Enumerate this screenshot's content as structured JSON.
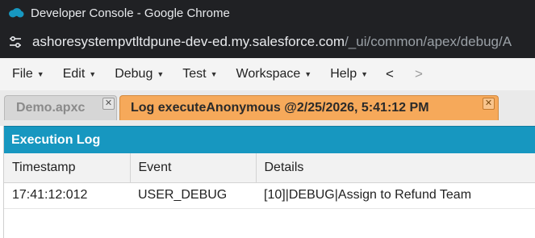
{
  "window": {
    "title": "Developer Console - Google Chrome",
    "logo_icon": "salesforce-cloud-icon"
  },
  "urlbar": {
    "host": "ashoresystempvtltdpune-dev-ed.my.salesforce.com",
    "path": "/_ui/common/apex/debug/A",
    "site_settings_icon": "tune-icon"
  },
  "menubar": {
    "items": [
      {
        "label": "File"
      },
      {
        "label": "Edit"
      },
      {
        "label": "Debug"
      },
      {
        "label": "Test"
      },
      {
        "label": "Workspace"
      },
      {
        "label": "Help"
      }
    ],
    "back_label": "<",
    "forward_label": ">"
  },
  "tabs": [
    {
      "label": "Demo.apxc",
      "active": false
    },
    {
      "label": "Log executeAnonymous @2/25/2026, 5:41:12 PM",
      "active": true
    }
  ],
  "panel": {
    "title": "Execution Log",
    "columns": [
      "Timestamp",
      "Event",
      "Details"
    ],
    "rows": [
      {
        "timestamp": "17:41:12:012",
        "event": "USER_DEBUG",
        "details": "[10]|DEBUG|Assign to Refund Team"
      }
    ]
  },
  "colors": {
    "chrome_bg": "#202124",
    "header_accent": "#1797c0",
    "active_tab": "#f6a95a"
  }
}
